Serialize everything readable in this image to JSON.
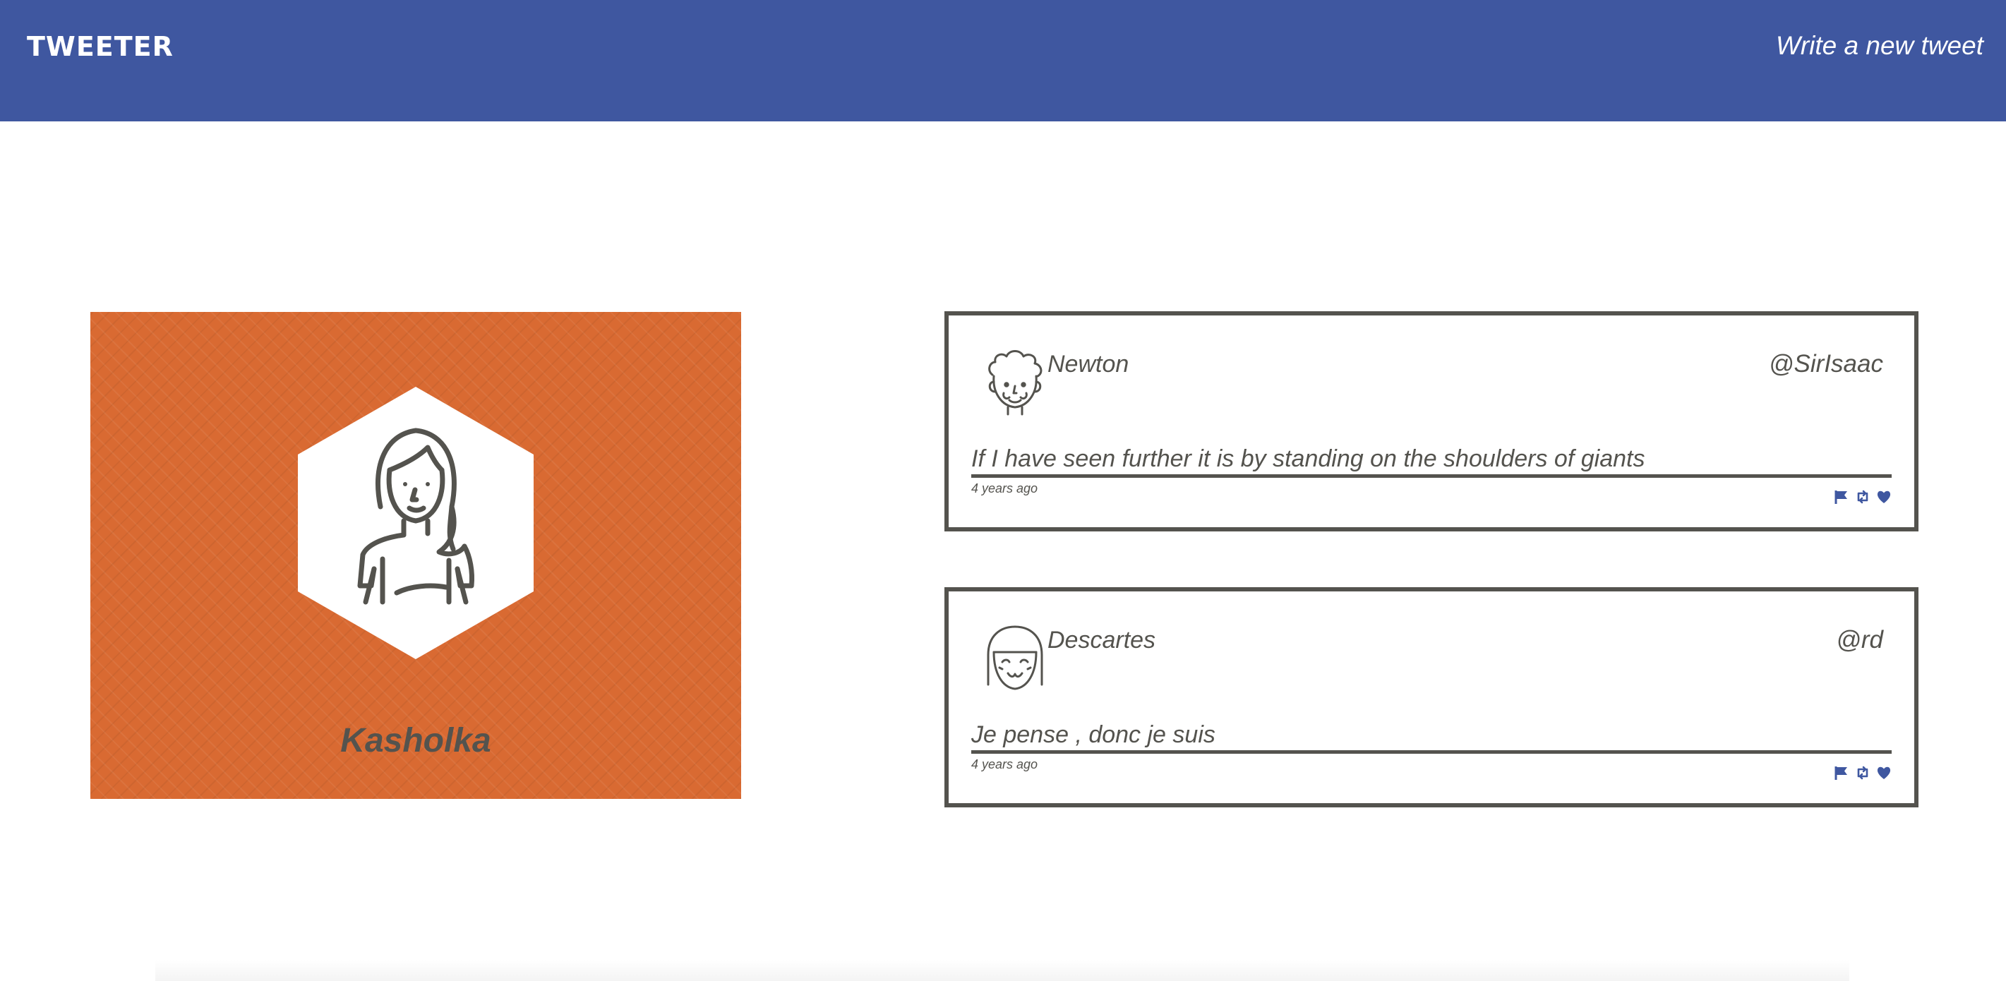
{
  "navbar": {
    "brand": "TWEETER",
    "new_tweet_label": "Write a new tweet",
    "color": "#3f57a0"
  },
  "profile": {
    "name": "Kasholka",
    "avatar_icon": "woman-avatar-icon",
    "card_color": "#d96a32"
  },
  "tweets": [
    {
      "name": "Newton",
      "handle": "@SirIsaac",
      "content": "If I have seen further it is by standing on the shoulders of giants",
      "time": "4 years ago",
      "avatar_icon": "curly-haired-man-avatar-icon"
    },
    {
      "name": "Descartes",
      "handle": "@rd",
      "content": "Je pense , donc je suis",
      "time": "4 years ago",
      "avatar_icon": "bob-haired-woman-avatar-icon"
    }
  ],
  "actions": [
    "flag-icon",
    "retweet-icon",
    "heart-icon"
  ],
  "action_color": "#3f57a0"
}
